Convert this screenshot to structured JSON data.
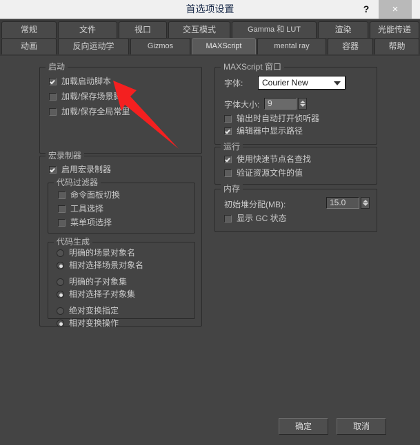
{
  "window": {
    "title": "首选项设置",
    "help_label": "?",
    "close_label": "×"
  },
  "tabs": {
    "row1": [
      {
        "label": "常规",
        "selected": false
      },
      {
        "label": "文件",
        "selected": false
      },
      {
        "label": "视口",
        "selected": false
      },
      {
        "label": "交互模式",
        "selected": false
      },
      {
        "label": "Gamma 和 LUT",
        "selected": false
      },
      {
        "label": "渲染",
        "selected": false
      },
      {
        "label": "光能传递",
        "selected": false
      }
    ],
    "row2": [
      {
        "label": "动画",
        "selected": false
      },
      {
        "label": "反向运动学",
        "selected": false
      },
      {
        "label": "Gizmos",
        "selected": false
      },
      {
        "label": "MAXScript",
        "selected": true
      },
      {
        "label": "mental ray",
        "selected": false
      },
      {
        "label": "容器",
        "selected": false
      },
      {
        "label": "帮助",
        "selected": false
      }
    ]
  },
  "startup": {
    "caption": "启动",
    "items": [
      {
        "label": "加载启动脚本",
        "checked": true
      },
      {
        "label": "加载/保存场景脚本",
        "checked": false
      },
      {
        "label": "加载/保存全局常里",
        "checked": false
      }
    ]
  },
  "macro_recorder": {
    "caption": "宏录制器",
    "enable": {
      "label": "启用宏录制器",
      "checked": true
    },
    "code_filter": {
      "caption": "代码过滤器",
      "items": [
        {
          "label": "命令面板切换",
          "checked": false
        },
        {
          "label": "工具选择",
          "checked": false
        },
        {
          "label": "菜单项选择",
          "checked": false
        }
      ]
    },
    "code_gen": {
      "caption": "代码生成",
      "groups": [
        [
          {
            "label": "明确的场景对象名",
            "selected": false
          },
          {
            "label": "相对选择场景对象名",
            "selected": true
          }
        ],
        [
          {
            "label": "明确的子对象集",
            "selected": false
          },
          {
            "label": "相对选择子对象集",
            "selected": true
          }
        ],
        [
          {
            "label": "绝对变换指定",
            "selected": false
          },
          {
            "label": "相对变换操作",
            "selected": true
          }
        ]
      ]
    }
  },
  "maxscript_window": {
    "caption": "MAXScript 窗口",
    "font_label": "字体:",
    "font_value": "Courier New",
    "font_size_label": "字体大小:",
    "font_size_value": "9",
    "checks": [
      {
        "label": "输出时自动打开侦听器",
        "checked": false
      },
      {
        "label": "编辑器中显示路径",
        "checked": true
      }
    ]
  },
  "run": {
    "caption": "运行",
    "items": [
      {
        "label": "使用快速节点名查找",
        "checked": true
      },
      {
        "label": "验证资源文件的值",
        "checked": false
      }
    ]
  },
  "memory": {
    "caption": "内存",
    "heap_label": "初始堆分配(MB):",
    "heap_value": "15.0",
    "gc": {
      "label": "显示 GC 状态",
      "checked": false
    }
  },
  "footer": {
    "ok_label": "确定",
    "cancel_label": "取消"
  },
  "annotation": {
    "arrow_color": "#f42020"
  }
}
